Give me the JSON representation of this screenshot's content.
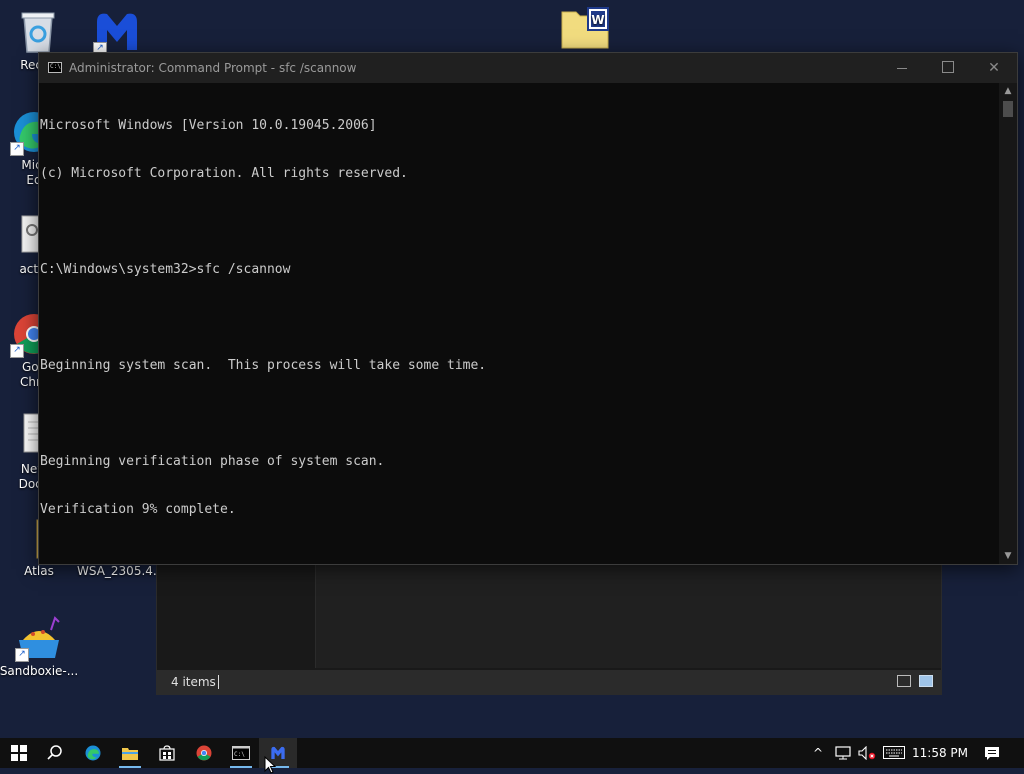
{
  "desktop": {
    "icons": [
      {
        "label": "Recyc"
      },
      {
        "label": ""
      },
      {
        "label": ""
      },
      {
        "label": "Micr",
        "label2": "Ed"
      },
      {
        "label": "activ"
      },
      {
        "label": "Goo",
        "label2": "Chro"
      },
      {
        "label": "New",
        "label2": "Docu"
      },
      {
        "label": "Atlas"
      },
      {
        "label": "WSA_2305.4..."
      },
      {
        "label": "Sandboxie-..."
      }
    ]
  },
  "explorer": {
    "status_items": "4 items"
  },
  "cmd": {
    "title": "Administrator: Command Prompt - sfc  /scannow",
    "icon_text": "C:\\",
    "lines": [
      "Microsoft Windows [Version 10.0.19045.2006]",
      "(c) Microsoft Corporation. All rights reserved.",
      "",
      "C:\\Windows\\system32>sfc /scannow",
      "",
      "Beginning system scan.  This process will take some time.",
      "",
      "Beginning verification phase of system scan.",
      "Verification 9% complete."
    ],
    "controls": {
      "close": "✕"
    }
  },
  "taskbar": {
    "clock": "11:58 PM",
    "icons": [
      "windows-start-icon",
      "search-icon",
      "edge-icon",
      "file-explorer-icon",
      "store-icon",
      "chrome-icon",
      "cmd-icon",
      "malwarebytes-icon"
    ],
    "tray": {
      "chevron": "^"
    }
  },
  "colors": {
    "desktop_bg": "#17203a",
    "console_bg": "#0c0c0c",
    "console_text": "#cccccc",
    "taskbar_bg": "#101010",
    "accent": "#76b9ed"
  }
}
